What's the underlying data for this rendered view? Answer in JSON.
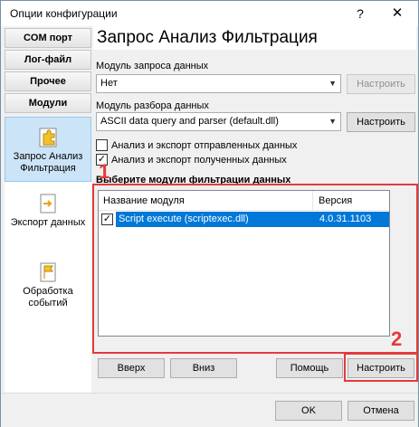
{
  "window": {
    "title": "Опции конфигурации",
    "help": "?",
    "close": "✕"
  },
  "sidebar": {
    "buttons": [
      "COM порт",
      "Лог-файл",
      "Прочее",
      "Модули"
    ],
    "items": [
      {
        "label": "Запрос Анализ Фильтрация",
        "icon": "puzzle-icon",
        "active": true
      },
      {
        "label": "Экспорт данных",
        "icon": "export-icon",
        "active": false
      },
      {
        "label": "Обработка событий",
        "icon": "event-flag-icon",
        "active": false
      }
    ]
  },
  "main": {
    "heading": "Запрос Анализ Фильтрация",
    "query_module_label": "Модуль запроса данных",
    "query_module_value": "Нет",
    "query_configure": "Настроить",
    "parser_module_label": "Модуль разбора данных",
    "parser_module_value": "ASCII data query and parser (default.dll)",
    "parser_configure": "Настроить",
    "analyze_sent": {
      "label": "Анализ и экспорт отправленных данных",
      "checked": false
    },
    "analyze_received": {
      "label": "Анализ и экспорт полученных данных",
      "checked": true
    },
    "filter_section_label": "Выберите модули фильтрации данных",
    "filter_list": {
      "columns": [
        "Название модуля",
        "Версия"
      ],
      "rows": [
        {
          "name": "Script execute (scriptexec.dll)",
          "version": "4.0.31.1103",
          "checked": true,
          "selected": true
        }
      ]
    },
    "buttons": {
      "up": "Вверх",
      "down": "Вниз",
      "help": "Помощь",
      "configure": "Настроить"
    }
  },
  "annotations": {
    "marker1": "1",
    "marker2": "2",
    "color": "#e5393b"
  },
  "footer": {
    "ok": "OK",
    "cancel": "Отмена"
  },
  "colors": {
    "selection": "#0078d7",
    "active_side": "#cce4f7"
  }
}
